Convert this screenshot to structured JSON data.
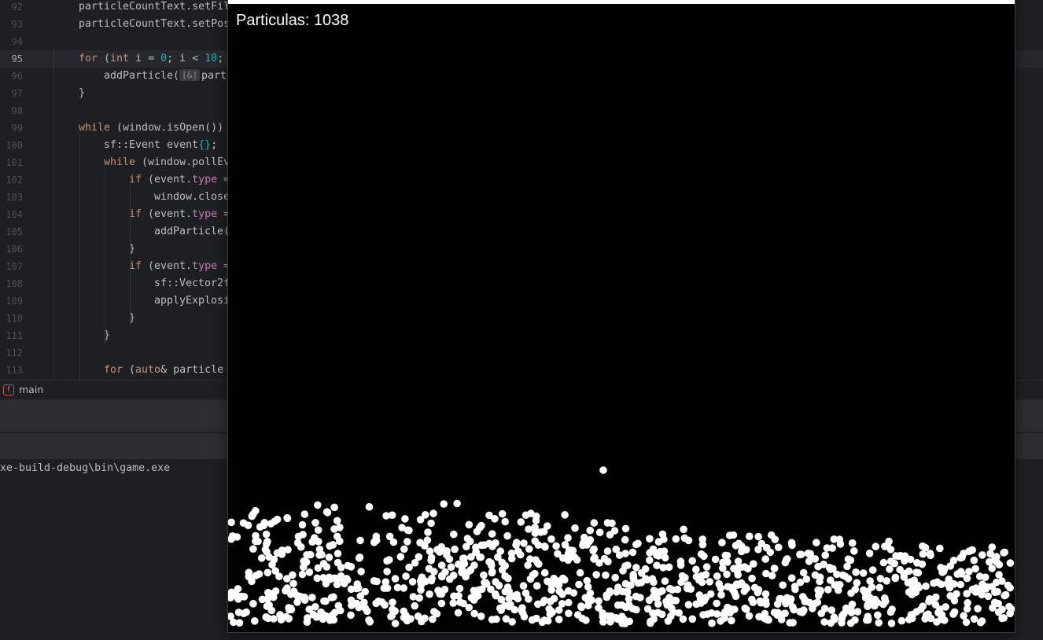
{
  "editor": {
    "lines": [
      {
        "n": "92",
        "indent": 0,
        "segments": [
          {
            "t": "particleCountText.setFil",
            "c": "plain"
          }
        ]
      },
      {
        "n": "93",
        "indent": 0,
        "segments": [
          {
            "t": "particleCountText.setPos",
            "c": "plain"
          }
        ]
      },
      {
        "n": "94",
        "indent": 0,
        "segments": []
      },
      {
        "n": "95",
        "indent": 0,
        "current": true,
        "segments": [
          {
            "t": "for",
            "c": "kw"
          },
          {
            "t": " (",
            "c": "plain"
          },
          {
            "t": "int",
            "c": "kw"
          },
          {
            "t": " i = ",
            "c": "plain"
          },
          {
            "t": "0",
            "c": "num"
          },
          {
            "t": "; i < ",
            "c": "plain"
          },
          {
            "t": "10",
            "c": "num"
          },
          {
            "t": ";",
            "c": "plain"
          }
        ]
      },
      {
        "n": "96",
        "indent": 1,
        "segments": [
          {
            "t": "addParticle(",
            "c": "plain"
          },
          {
            "t": "[&]",
            "c": "hint"
          },
          {
            "t": "parti",
            "c": "plain"
          }
        ]
      },
      {
        "n": "97",
        "indent": 0,
        "segments": [
          {
            "t": "}",
            "c": "plain"
          }
        ]
      },
      {
        "n": "98",
        "indent": 0,
        "segments": []
      },
      {
        "n": "99",
        "indent": 0,
        "segments": [
          {
            "t": "while",
            "c": "kw"
          },
          {
            "t": " (window.isOpen())",
            "c": "plain"
          }
        ]
      },
      {
        "n": "100",
        "indent": 1,
        "segments": [
          {
            "t": "sf::Event event",
            "c": "plain"
          },
          {
            "t": "{}",
            "c": "num"
          },
          {
            "t": ";",
            "c": "plain"
          }
        ]
      },
      {
        "n": "101",
        "indent": 1,
        "segments": [
          {
            "t": "while",
            "c": "kw"
          },
          {
            "t": " (window.pollEv",
            "c": "plain"
          }
        ]
      },
      {
        "n": "102",
        "indent": 2,
        "segments": [
          {
            "t": "if",
            "c": "kw"
          },
          {
            "t": " (event.",
            "c": "plain"
          },
          {
            "t": "type",
            "c": "field"
          },
          {
            "t": " =",
            "c": "plain"
          }
        ]
      },
      {
        "n": "103",
        "indent": 3,
        "segments": [
          {
            "t": "window.close",
            "c": "plain"
          }
        ]
      },
      {
        "n": "104",
        "indent": 2,
        "segments": [
          {
            "t": "if",
            "c": "kw"
          },
          {
            "t": " (event.",
            "c": "plain"
          },
          {
            "t": "type",
            "c": "field"
          },
          {
            "t": " =",
            "c": "plain"
          }
        ]
      },
      {
        "n": "105",
        "indent": 3,
        "segments": [
          {
            "t": "addParticle(",
            "c": "plain"
          }
        ]
      },
      {
        "n": "106",
        "indent": 2,
        "segments": [
          {
            "t": "}",
            "c": "plain"
          }
        ]
      },
      {
        "n": "107",
        "indent": 2,
        "segments": [
          {
            "t": "if",
            "c": "kw"
          },
          {
            "t": " (event.",
            "c": "plain"
          },
          {
            "t": "type",
            "c": "field"
          },
          {
            "t": " =",
            "c": "plain"
          }
        ]
      },
      {
        "n": "108",
        "indent": 3,
        "segments": [
          {
            "t": "sf::Vector2f",
            "c": "plain"
          }
        ]
      },
      {
        "n": "109",
        "indent": 3,
        "segments": [
          {
            "t": "applyExplosi",
            "c": "plain"
          }
        ]
      },
      {
        "n": "110",
        "indent": 2,
        "segments": [
          {
            "t": "}",
            "c": "plain"
          }
        ]
      },
      {
        "n": "111",
        "indent": 1,
        "segments": [
          {
            "t": "}",
            "c": "plain"
          }
        ]
      },
      {
        "n": "112",
        "indent": 0,
        "segments": []
      },
      {
        "n": "113",
        "indent": 1,
        "segments": [
          {
            "t": "for",
            "c": "kw"
          },
          {
            "t": " (",
            "c": "plain"
          },
          {
            "t": "auto",
            "c": "kw"
          },
          {
            "t": "& particle",
            "c": "plain"
          }
        ]
      }
    ]
  },
  "breadcrumb": {
    "icon": "function-icon",
    "badge": "f",
    "label": "main"
  },
  "console": {
    "path": "xe-build-debug\\bin\\game.exe"
  },
  "game": {
    "particle_count_text": "Particulas: 1038",
    "particle_count": 1038
  },
  "colors": {
    "editor_bg": "#1e1f22",
    "keyword": "#cf8e6d",
    "number": "#2aacb8",
    "field": "#c77dbb",
    "particle": "#ffffff",
    "game_bg": "#000000"
  }
}
